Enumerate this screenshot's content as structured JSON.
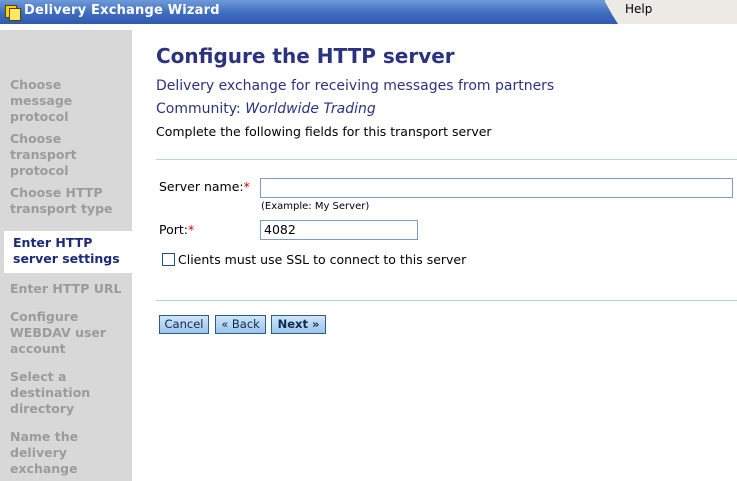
{
  "window": {
    "title": "Delivery Exchange Wizard",
    "help_label": "Help"
  },
  "steps": [
    {
      "label": "Choose\nmessage\nprotocol",
      "state": "done"
    },
    {
      "label": "Choose\ntransport\nprotocol",
      "state": "done"
    },
    {
      "label": "Choose HTTP\ntransport type",
      "state": "done"
    },
    {
      "label": "Enter HTTP\nserver settings",
      "state": "active"
    },
    {
      "label": "Enter HTTP URL",
      "state": "pending"
    },
    {
      "label": "Configure\nWEBDAV user\naccount",
      "state": "pending"
    },
    {
      "label": "Select a\ndestination\ndirectory",
      "state": "pending"
    },
    {
      "label": "Name the\ndelivery\nexchange",
      "state": "pending"
    }
  ],
  "page": {
    "heading": "Configure the HTTP server",
    "subheading": "Delivery exchange for receiving messages from partners",
    "community_label": "Community:",
    "community_name": "Worldwide Trading",
    "description": "Complete the following fields for this transport server"
  },
  "form": {
    "server_name_label": "Server name:",
    "server_name_value": "",
    "server_name_example": "(Example: My Server)",
    "port_label": "Port:",
    "port_value": "4082",
    "required_mark": "*",
    "ssl_label": "Clients must use SSL to connect to this server",
    "ssl_checked": false
  },
  "buttons": {
    "cancel": "Cancel",
    "back": "« Back",
    "next": "Next »"
  }
}
